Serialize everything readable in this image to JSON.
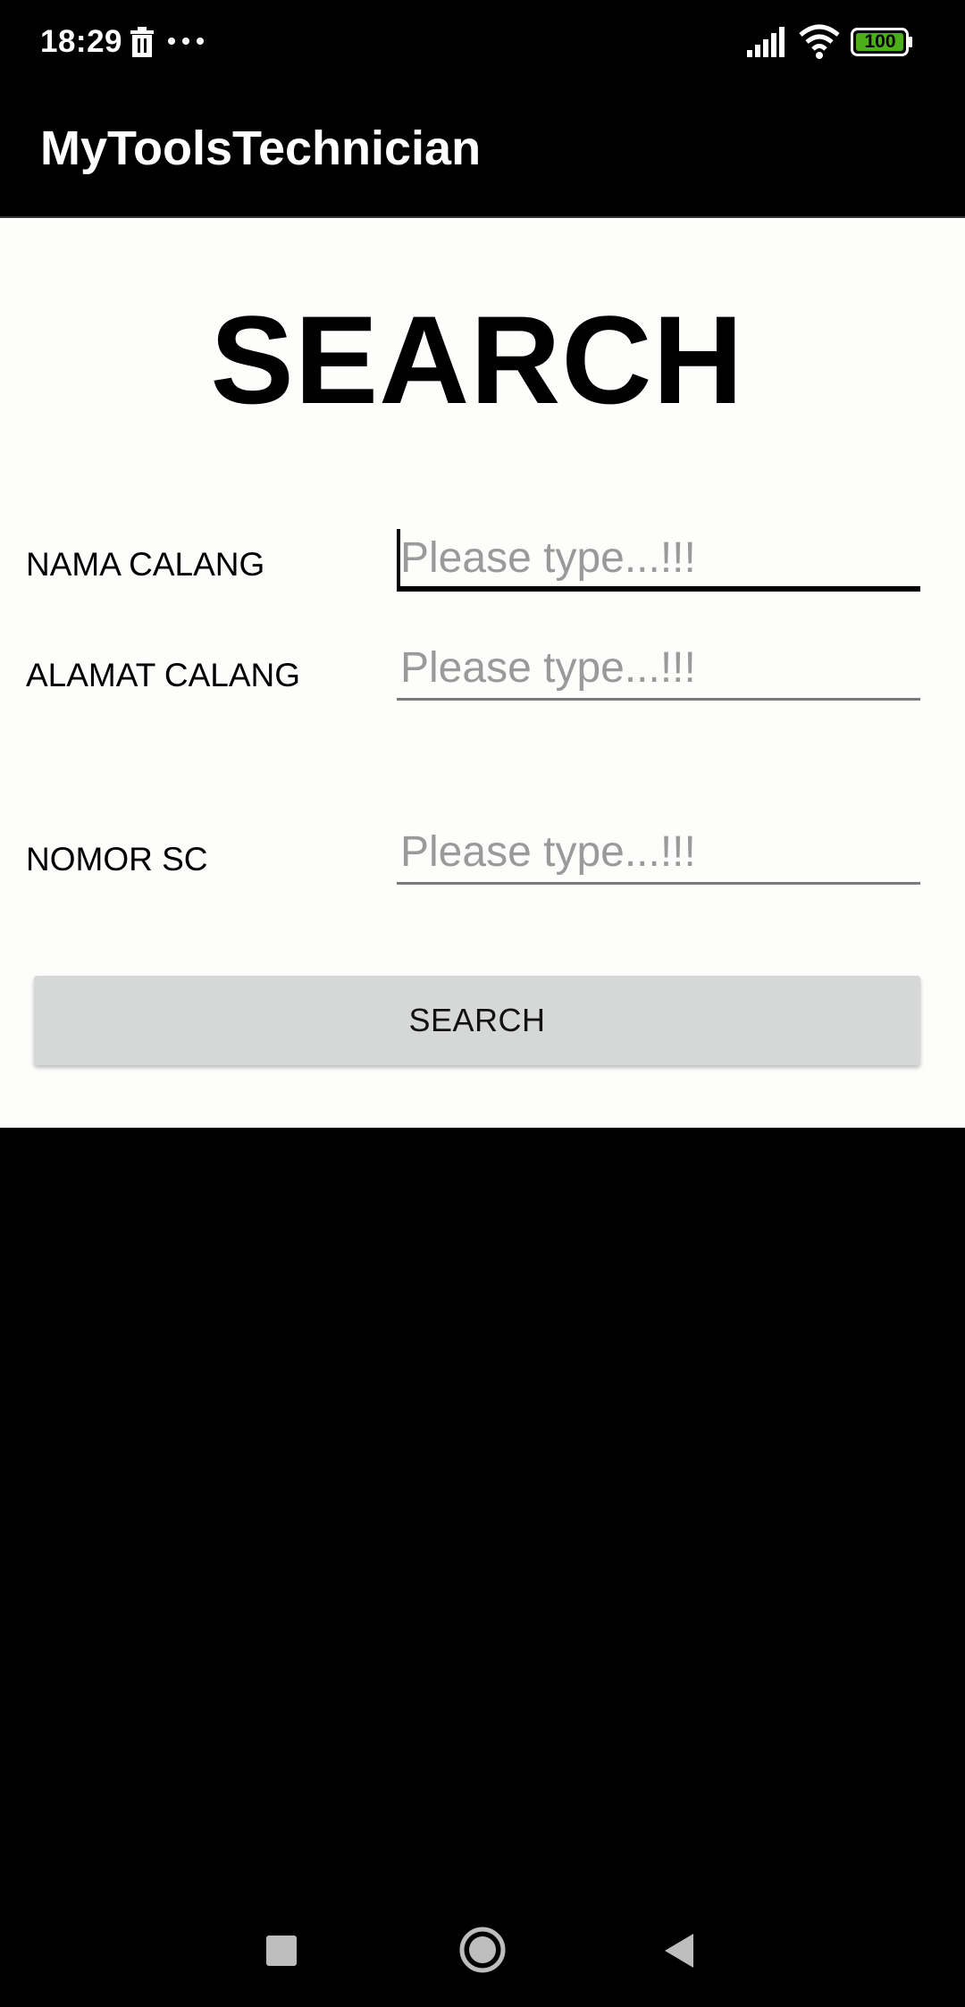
{
  "status_bar": {
    "time": "18:29",
    "battery": "100",
    "icons": [
      "trash-icon",
      "more-dots-icon",
      "signal-icon",
      "wifi-icon",
      "battery-icon"
    ],
    "battery_color": "#4caf1a"
  },
  "app_bar": {
    "title": "MyToolsTechnician"
  },
  "main": {
    "heading": "SEARCH",
    "fields": [
      {
        "label": "NAMA CALANG",
        "value": "",
        "placeholder": "Please type...!!!"
      },
      {
        "label": "ALAMAT CALANG",
        "value": "",
        "placeholder": "Please type...!!!"
      },
      {
        "label": "NOMOR SC",
        "value": "",
        "placeholder": "Please type...!!!"
      }
    ],
    "search_button_label": "SEARCH"
  },
  "nav_bar": {
    "icons": [
      "recents-square-icon",
      "home-circle-icon",
      "back-triangle-icon"
    ]
  },
  "colors": {
    "background": "#000000",
    "content_background": "#fdfdfc",
    "button_background": "#d6d7d7",
    "placeholder": "#9a9a9a"
  }
}
